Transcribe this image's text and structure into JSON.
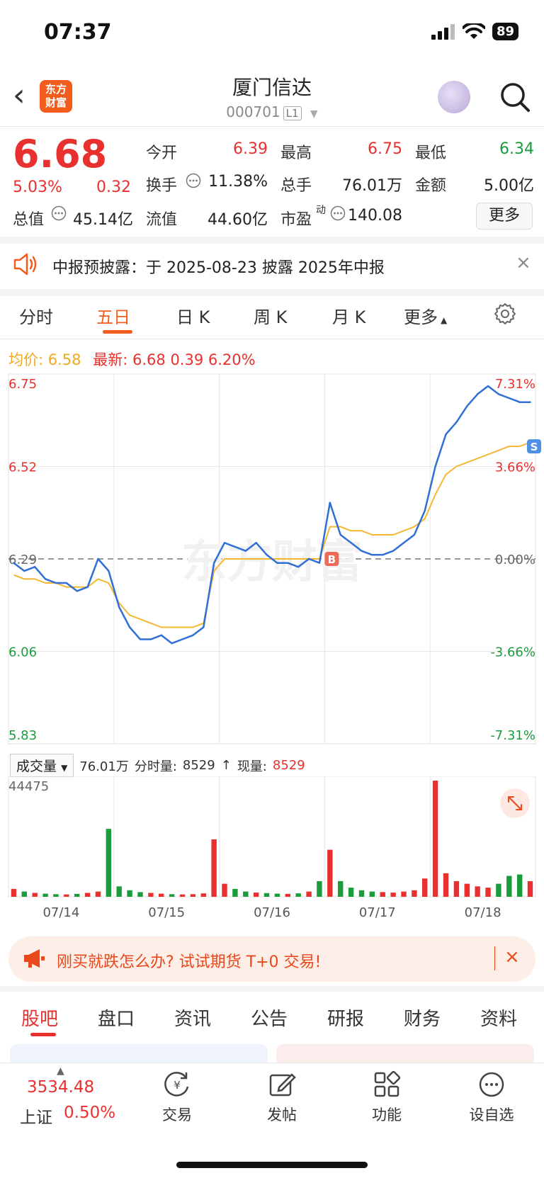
{
  "status": {
    "time": "07:37",
    "battery": "89"
  },
  "header": {
    "logo_line1": "东方",
    "logo_line2": "财富",
    "name": "厦门信达",
    "code": "000701",
    "level": "L1"
  },
  "quote": {
    "price": "6.68",
    "pct": "5.03%",
    "change": "0.32",
    "rows": [
      [
        {
          "label": "今开",
          "value": "6.39"
        },
        {
          "label": "最高",
          "value": "6.75"
        },
        {
          "label": "最低",
          "value": "6.34"
        }
      ],
      [
        {
          "label": "换手",
          "value": "11.38%"
        },
        {
          "label": "总手",
          "value": "76.01万"
        },
        {
          "label": "金额",
          "value": "5.00亿"
        }
      ],
      [
        {
          "label": "总值",
          "value": "45.14亿"
        },
        {
          "label": "流值",
          "value": "44.60亿"
        },
        {
          "label": "市盈",
          "sup": "动",
          "value": "140.08"
        }
      ]
    ],
    "more": "更多"
  },
  "notice": {
    "text": "中报预披露：于 2025-08-23 披露 2025年中报",
    "close": "×"
  },
  "tabs": [
    "分时",
    "五日",
    "日 K",
    "周 K",
    "月 K",
    "更多"
  ],
  "active_tab": "五日",
  "info_line": {
    "avg_label": "均价:",
    "avg_value": "6.58",
    "latest_label": "最新:",
    "latest_value": "6.68",
    "latest_change": "0.39",
    "latest_pct": "6.20%"
  },
  "colors": {
    "price_line": "#2f6fd6",
    "avg_line": "#f5b731",
    "up": "#e8312f",
    "down": "#1a9c3c",
    "accent": "#f25d1e"
  },
  "chart_data": {
    "type": "line",
    "x_days": [
      "07/14",
      "07/15",
      "07/16",
      "07/17",
      "07/18"
    ],
    "y_ticks_left": [
      "6.75",
      "6.52",
      "6.29",
      "6.06",
      "5.83"
    ],
    "y_ticks_right": [
      "7.31%",
      "3.66%",
      "0.00%",
      "-3.66%",
      "-7.31%"
    ],
    "ylim": [
      5.83,
      6.75
    ],
    "prev_close": 6.29,
    "watermark": "东方财富",
    "markers": [
      {
        "label": "B",
        "day": "07/17",
        "price": 6.29
      },
      {
        "label": "S",
        "day": "07/18",
        "price": 6.57
      }
    ],
    "series": [
      {
        "name": "价格",
        "values": [
          6.28,
          6.26,
          6.27,
          6.24,
          6.23,
          6.23,
          6.21,
          6.22,
          6.29,
          6.26,
          6.17,
          6.12,
          6.09,
          6.09,
          6.1,
          6.08,
          6.09,
          6.1,
          6.12,
          6.28,
          6.33,
          6.32,
          6.31,
          6.33,
          6.3,
          6.28,
          6.28,
          6.27,
          6.29,
          6.28,
          6.43,
          6.35,
          6.33,
          6.31,
          6.3,
          6.3,
          6.31,
          6.33,
          6.35,
          6.41,
          6.52,
          6.6,
          6.63,
          6.67,
          6.7,
          6.72,
          6.7,
          6.69,
          6.68,
          6.68
        ]
      },
      {
        "name": "均价",
        "values": [
          6.25,
          6.24,
          6.24,
          6.23,
          6.23,
          6.22,
          6.22,
          6.22,
          6.24,
          6.23,
          6.18,
          6.15,
          6.14,
          6.13,
          6.12,
          6.12,
          6.12,
          6.12,
          6.13,
          6.26,
          6.29,
          6.29,
          6.29,
          6.29,
          6.29,
          6.29,
          6.29,
          6.29,
          6.29,
          6.29,
          6.37,
          6.37,
          6.36,
          6.36,
          6.35,
          6.35,
          6.35,
          6.36,
          6.37,
          6.39,
          6.45,
          6.5,
          6.52,
          6.53,
          6.54,
          6.55,
          6.56,
          6.57,
          6.57,
          6.58
        ]
      }
    ],
    "volume": {
      "header_select": "成交量",
      "total": "76.01万",
      "bar_label": "分时量:",
      "bar_value": "8529",
      "arrow": "↑",
      "now_label": "现量:",
      "now_value": "8529",
      "max_tick": "44475",
      "bars": [
        3000,
        2000,
        1500,
        1200,
        1000,
        900,
        1100,
        1500,
        2000,
        26000,
        4000,
        2500,
        1800,
        1500,
        1200,
        1000,
        900,
        1000,
        1300,
        22000,
        5000,
        3000,
        2000,
        1600,
        1400,
        1200,
        1100,
        1300,
        2000,
        6000,
        18000,
        6000,
        3500,
        2500,
        2000,
        1800,
        1600,
        2000,
        2500,
        7000,
        44475,
        9000,
        6000,
        5000,
        4000,
        3500,
        5000,
        8000,
        8529,
        6000
      ]
    }
  },
  "promo": {
    "text": "刚买就跌怎么办? 试试期货 T+0 交易!",
    "close": "×"
  },
  "bottom_tabs": [
    "股吧",
    "盘口",
    "资讯",
    "公告",
    "研报",
    "财务",
    "资料"
  ],
  "bottom_tab_active": "股吧",
  "index": {
    "value": "3534.48",
    "name": "上证",
    "pct": "0.50%"
  },
  "nav": [
    "交易",
    "发帖",
    "功能",
    "设自选"
  ]
}
